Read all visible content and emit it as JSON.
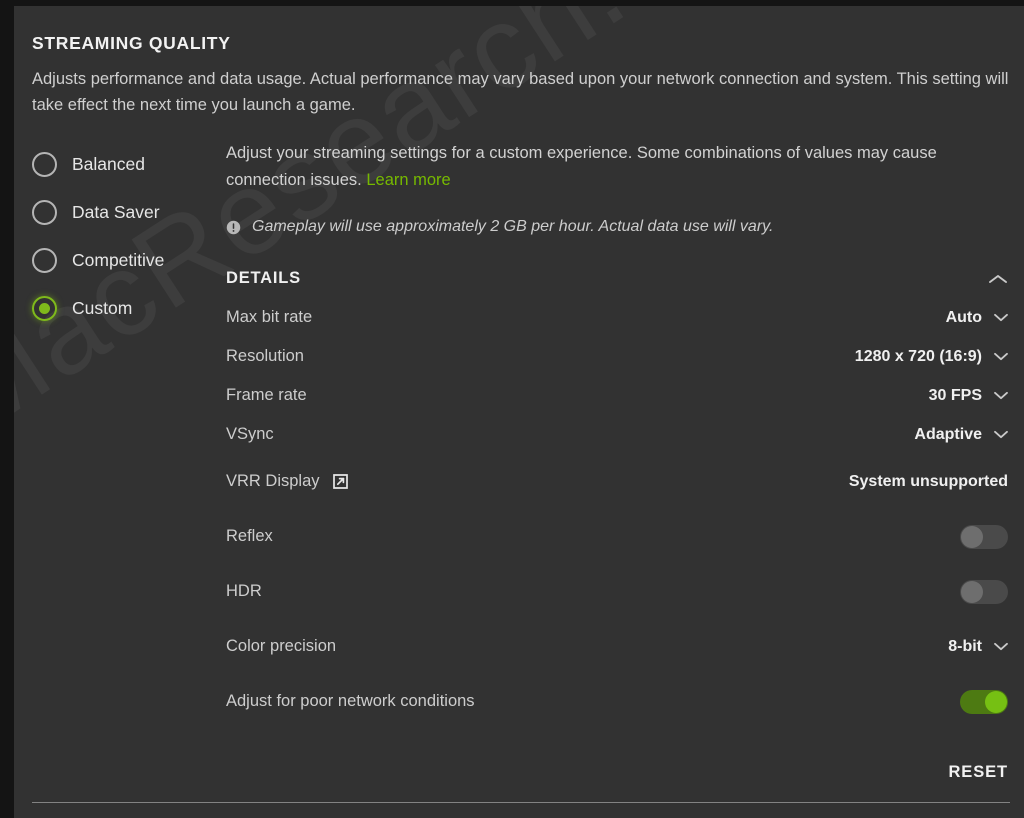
{
  "watermark": {
    "text": "MacResearch.org"
  },
  "section": {
    "title": "STREAMING QUALITY",
    "description": "Adjusts performance and data usage. Actual performance may vary based upon your network connection and system. This setting will take effect the next time you launch a game."
  },
  "quality_modes": {
    "selected": "Custom",
    "options": [
      {
        "label": "Balanced",
        "selected": false
      },
      {
        "label": "Data Saver",
        "selected": false
      },
      {
        "label": "Competitive",
        "selected": false
      },
      {
        "label": "Custom",
        "selected": true
      }
    ]
  },
  "custom": {
    "description": "Adjust your streaming settings for a custom experience. Some combinations of values may cause connection issues.",
    "learn_more_label": "Learn more",
    "note": "Gameplay will use approximately 2 GB per hour. Actual data use will vary.",
    "note_icon": "exclamation-circle-icon"
  },
  "details": {
    "title": "DETAILS",
    "collapse_icon": "chevron-up-icon",
    "expanded": true,
    "settings": [
      {
        "label": "Max bit rate",
        "value": "Auto",
        "control": "dropdown"
      },
      {
        "label": "Resolution",
        "value": "1280 x 720 (16:9)",
        "control": "dropdown"
      },
      {
        "label": "Frame rate",
        "value": "30 FPS",
        "control": "dropdown"
      },
      {
        "label": "VSync",
        "value": "Adaptive",
        "control": "dropdown"
      },
      {
        "label": "VRR Display",
        "value": "System unsupported",
        "control": "text",
        "link_icon": "external-link-icon"
      },
      {
        "label": "Reflex",
        "value": "off",
        "control": "toggle"
      },
      {
        "label": "HDR",
        "value": "off",
        "control": "toggle"
      },
      {
        "label": "Color precision",
        "value": "8-bit",
        "control": "dropdown"
      },
      {
        "label": "Adjust for poor network conditions",
        "value": "on",
        "control": "toggle"
      }
    ],
    "reset_label": "RESET"
  },
  "colors": {
    "accent_green": "#76b900",
    "toggle_on_track": "#4d7a12",
    "toggle_on_knob": "#76c013",
    "panel_bg": "#323232",
    "page_bg": "#141414",
    "text_primary": "#f0f0f0",
    "text_secondary": "#cdcdcd"
  }
}
